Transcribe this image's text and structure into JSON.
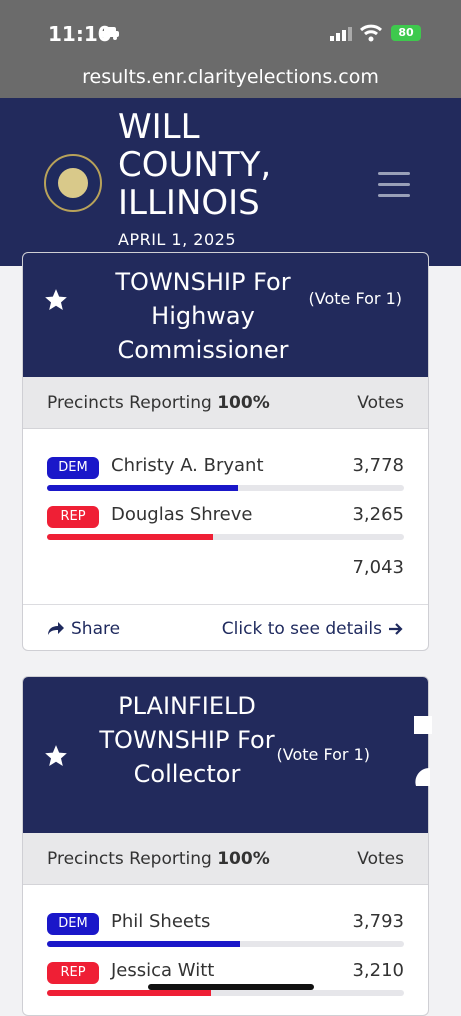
{
  "status": {
    "time": "11:10",
    "battery": "80"
  },
  "browser": {
    "url": "results.enr.clarityelections.com"
  },
  "header": {
    "county": "WILL COUNTY, ILLINOIS",
    "date": "APRIL 1, 2025"
  },
  "races": [
    {
      "title": "TOWNSHIP For Highway Commissioner",
      "vote_for": "(Vote For 1)",
      "precincts_label": "Precincts Reporting",
      "precincts_value": "100%",
      "votes_header": "Votes",
      "candidates": [
        {
          "party": "DEM",
          "name": "Christy A. Bryant",
          "votes": "3,778",
          "share": 0.536
        },
        {
          "party": "REP",
          "name": "Douglas Shreve",
          "votes": "3,265",
          "share": 0.464
        }
      ],
      "total": "7,043",
      "share_label": "Share",
      "details_label": "Click to see details"
    },
    {
      "title": "PLAINFIELD TOWNSHIP For Collector",
      "vote_for": "(Vote For 1)",
      "precincts_label": "Precincts Reporting",
      "precincts_value": "100%",
      "votes_header": "Votes",
      "candidates": [
        {
          "party": "DEM",
          "name": "Phil Sheets",
          "votes": "3,793",
          "share": 0.541
        },
        {
          "party": "REP",
          "name": "Jessica Witt",
          "votes": "3,210",
          "share": 0.459
        }
      ]
    }
  ],
  "colors": {
    "navy": "#222a5c",
    "dem": "#1a17c9",
    "rep": "#ef1f35"
  }
}
